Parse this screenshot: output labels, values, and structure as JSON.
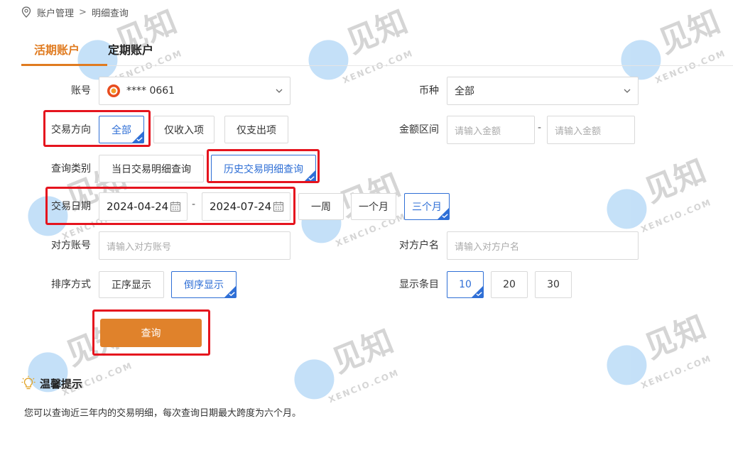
{
  "breadcrumb": {
    "root": "账户管理",
    "separator": ">",
    "current": "明细查询"
  },
  "tabs": [
    {
      "label": "活期账户",
      "active": true
    },
    {
      "label": "定期账户",
      "active": false
    }
  ],
  "account": {
    "label": "账号",
    "value": "**** 0661"
  },
  "currency": {
    "label": "币种",
    "value": "全部"
  },
  "direction": {
    "label": "交易方向",
    "options": [
      "全部",
      "仅收入项",
      "仅支出项"
    ],
    "selected": "全部"
  },
  "amount": {
    "label": "金额区间",
    "min_placeholder": "请输入金额",
    "max_placeholder": "请输入金额",
    "separator": "-"
  },
  "query_type": {
    "label": "查询类别",
    "options": [
      "当日交易明细查询",
      "历史交易明细查询"
    ],
    "selected": "历史交易明细查询"
  },
  "date": {
    "label": "交易日期",
    "start": "2024-04-24",
    "end": "2024-07-24",
    "separator": "-",
    "shortcuts": [
      "一周",
      "一个月",
      "三个月"
    ],
    "selected": "三个月"
  },
  "counterparty_account": {
    "label": "对方账号",
    "placeholder": "请输入对方账号"
  },
  "counterparty_name": {
    "label": "对方户名",
    "placeholder": "请输入对方户名"
  },
  "sort": {
    "label": "排序方式",
    "options": [
      "正序显示",
      "倒序显示"
    ],
    "selected": "倒序显示"
  },
  "page_size": {
    "label": "显示条目",
    "options": [
      "10",
      "20",
      "30"
    ],
    "selected": "10"
  },
  "query_button": {
    "label": "查询"
  },
  "tips": {
    "title": "温馨提示",
    "text": "您可以查询近三年内的交易明细，每次查询日期最大跨度为六个月。"
  },
  "watermark": {
    "brand": "见知",
    "domain": "XENCIO.COM"
  },
  "colors": {
    "accent": "#e07b20",
    "selected_blue": "#2f6fd6",
    "highlight_red": "#e5141e",
    "button_orange": "#e0822b"
  },
  "icons": {
    "breadcrumb": "location-pin-icon",
    "account": "bank-logo-icon",
    "dropdown": "chevron-down-icon",
    "date": "calendar-icon",
    "tips": "lightbulb-icon",
    "selected": "checkmark-icon"
  }
}
